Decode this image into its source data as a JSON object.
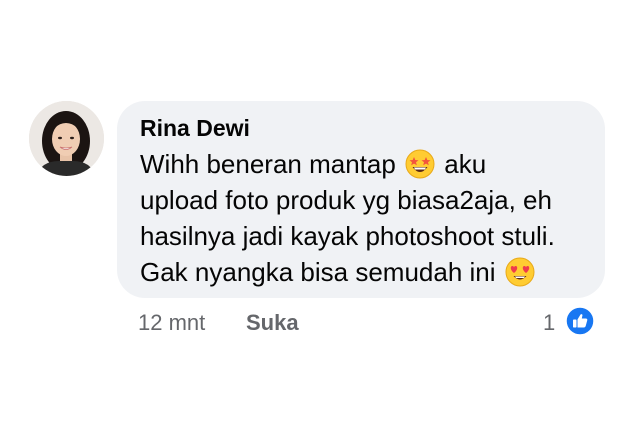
{
  "comment": {
    "author": "Rina Dewi",
    "lines": [
      {
        "before": "Wihh beneran mantap ",
        "emoji": "star-struck-emoji",
        "after": " aku"
      },
      {
        "text": "upload foto produk yg biasa2aja, eh"
      },
      {
        "text": "hasilnya jadi kayak photoshoot stuli."
      },
      {
        "before": "Gak nyangka bisa semudah ini ",
        "emoji": "heart-eyes-emoji",
        "after": ""
      }
    ]
  },
  "actions": {
    "time": "12 mnt",
    "like_label": "Suka"
  },
  "reactions": {
    "count": "1",
    "icon": "thumbs-up-icon",
    "color": "#1877f2"
  },
  "colors": {
    "bubble": "#f0f2f5",
    "text": "#050505",
    "meta": "#65676b"
  }
}
